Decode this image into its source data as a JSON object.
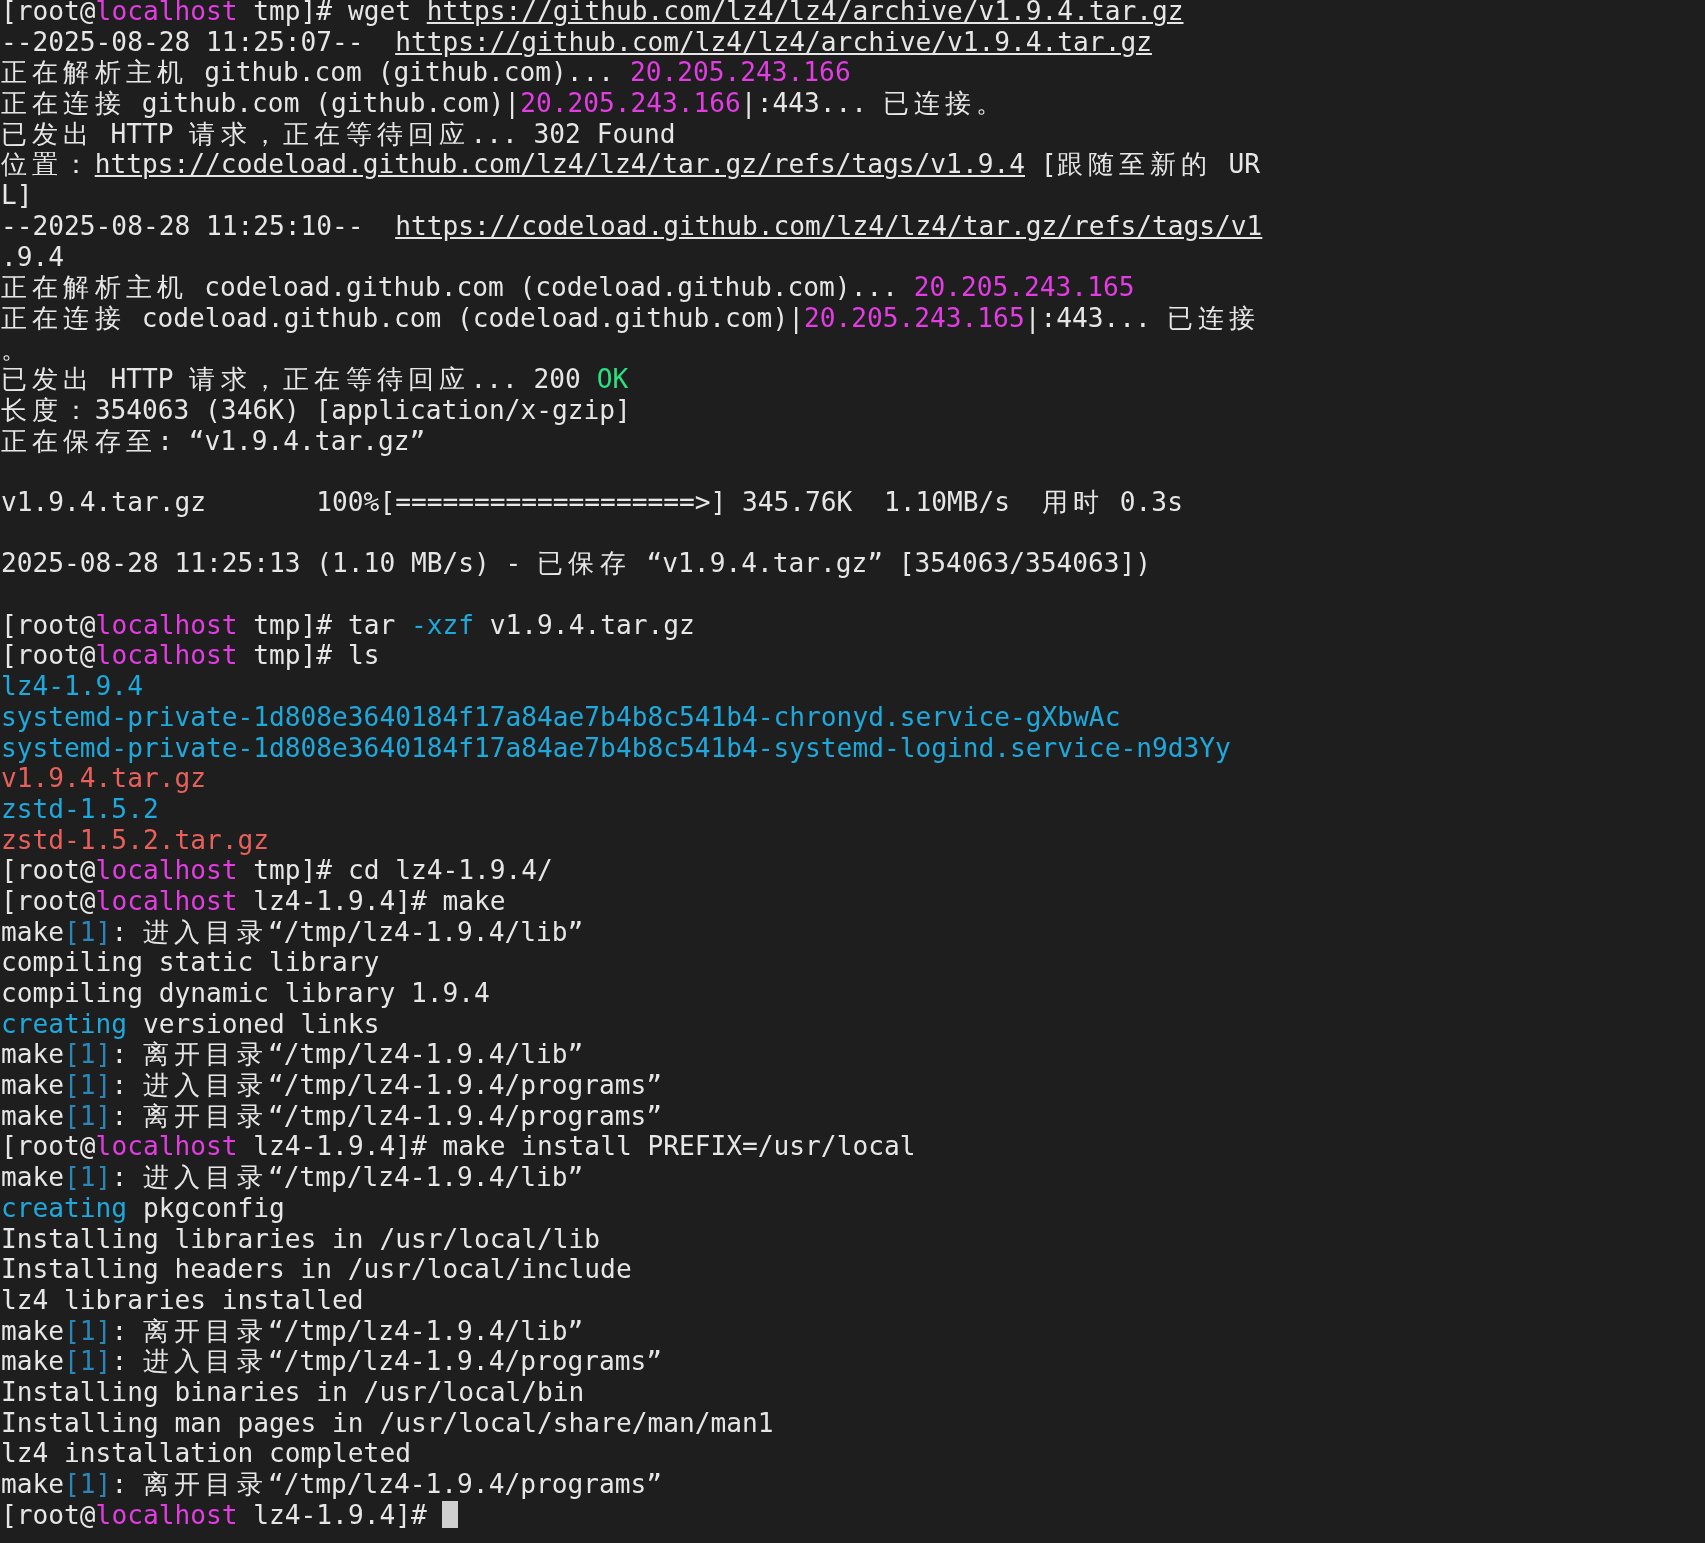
{
  "terminal": {
    "lines": [
      {
        "kind": "text",
        "segments": [
          {
            "kind": "plain",
            "text": "[root@"
          },
          {
            "kind": "host",
            "text": "localhost"
          },
          {
            "kind": "plain",
            "text": " tmp]# wget "
          },
          {
            "kind": "link",
            "text": "https://github.com/lz4/lz4/archive/v1.9.4.tar.gz"
          }
        ]
      },
      {
        "kind": "text",
        "segments": [
          {
            "kind": "plain",
            "text": "--2025-08-28 11:25:07--  "
          },
          {
            "kind": "link",
            "text": "https://github.com/lz4/lz4/archive/v1.9.4.tar.gz"
          }
        ]
      },
      {
        "kind": "text",
        "segments": [
          {
            "kind": "plain",
            "text": "正在解析主机 github.com (github.com)... "
          },
          {
            "kind": "ip",
            "text": "20.205.243.166"
          }
        ]
      },
      {
        "kind": "text",
        "segments": [
          {
            "kind": "plain",
            "text": "正在连接 github.com (github.com)|"
          },
          {
            "kind": "ip",
            "text": "20.205.243.166"
          },
          {
            "kind": "plain",
            "text": "|:443... 已连接。"
          }
        ]
      },
      {
        "kind": "text",
        "segments": [
          {
            "kind": "plain",
            "text": "已发出 HTTP 请求，正在等待回应... 302 Found"
          }
        ]
      },
      {
        "kind": "text",
        "segments": [
          {
            "kind": "plain",
            "text": "位置："
          },
          {
            "kind": "link",
            "text": "https://codeload.github.com/lz4/lz4/tar.gz/refs/tags/v1.9.4"
          },
          {
            "kind": "plain",
            "text": " [跟随至新的 UR"
          }
        ]
      },
      {
        "kind": "text",
        "segments": [
          {
            "kind": "plain",
            "text": "L]"
          }
        ]
      },
      {
        "kind": "text",
        "segments": [
          {
            "kind": "plain",
            "text": "--2025-08-28 11:25:10--  "
          },
          {
            "kind": "link",
            "text": "https://codeload.github.com/lz4/lz4/tar.gz/refs/tags/v1"
          }
        ]
      },
      {
        "kind": "text",
        "segments": [
          {
            "kind": "plain",
            "text": ".9.4"
          }
        ]
      },
      {
        "kind": "text",
        "segments": [
          {
            "kind": "plain",
            "text": "正在解析主机 codeload.github.com (codeload.github.com)... "
          },
          {
            "kind": "ip",
            "text": "20.205.243.165"
          }
        ]
      },
      {
        "kind": "text",
        "segments": [
          {
            "kind": "plain",
            "text": "正在连接 codeload.github.com (codeload.github.com)|"
          },
          {
            "kind": "ip",
            "text": "20.205.243.165"
          },
          {
            "kind": "plain",
            "text": "|:443... 已连接"
          }
        ]
      },
      {
        "kind": "text",
        "segments": [
          {
            "kind": "plain",
            "text": "。"
          }
        ]
      },
      {
        "kind": "text",
        "segments": [
          {
            "kind": "plain",
            "text": "已发出 HTTP 请求，正在等待回应... 200 "
          },
          {
            "kind": "ok",
            "text": "OK"
          }
        ]
      },
      {
        "kind": "text",
        "segments": [
          {
            "kind": "plain",
            "text": "长度：354063 (346K) [application/x-gzip]"
          }
        ]
      },
      {
        "kind": "text",
        "segments": [
          {
            "kind": "plain",
            "text": "正在保存至: “v1.9.4.tar.gz”"
          }
        ]
      },
      {
        "kind": "blank"
      },
      {
        "kind": "text",
        "segments": [
          {
            "kind": "plain",
            "text": "v1.9.4.tar.gz       100%[===================>] 345.76K  1.10MB/s  用时 0.3s"
          }
        ]
      },
      {
        "kind": "blank"
      },
      {
        "kind": "text",
        "segments": [
          {
            "kind": "plain",
            "text": "2025-08-28 11:25:13 (1.10 MB/s) - 已保存 “v1.9.4.tar.gz” [354063/354063])"
          }
        ]
      },
      {
        "kind": "blank"
      },
      {
        "kind": "text",
        "segments": [
          {
            "kind": "plain",
            "text": "[root@"
          },
          {
            "kind": "host",
            "text": "localhost"
          },
          {
            "kind": "plain",
            "text": " tmp]# tar "
          },
          {
            "kind": "option",
            "text": "-xzf"
          },
          {
            "kind": "plain",
            "text": " v1.9.4.tar.gz"
          }
        ]
      },
      {
        "kind": "text",
        "segments": [
          {
            "kind": "plain",
            "text": "[root@"
          },
          {
            "kind": "host",
            "text": "localhost"
          },
          {
            "kind": "plain",
            "text": " tmp]# ls"
          }
        ]
      },
      {
        "kind": "text",
        "segments": [
          {
            "kind": "dir",
            "text": "lz4-1.9.4"
          }
        ]
      },
      {
        "kind": "text",
        "segments": [
          {
            "kind": "dir",
            "text": "systemd-private-1d808e3640184f17a84ae7b4b8c541b4-chronyd.service-gXbwAc"
          }
        ]
      },
      {
        "kind": "text",
        "segments": [
          {
            "kind": "dir",
            "text": "systemd-private-1d808e3640184f17a84ae7b4b8c541b4-systemd-logind.service-n9d3Yy"
          }
        ]
      },
      {
        "kind": "text",
        "segments": [
          {
            "kind": "archive",
            "text": "v1.9.4.tar.gz"
          }
        ]
      },
      {
        "kind": "text",
        "segments": [
          {
            "kind": "dir",
            "text": "zstd-1.5.2"
          }
        ]
      },
      {
        "kind": "text",
        "segments": [
          {
            "kind": "archive",
            "text": "zstd-1.5.2.tar.gz"
          }
        ]
      },
      {
        "kind": "text",
        "segments": [
          {
            "kind": "plain",
            "text": "[root@"
          },
          {
            "kind": "host",
            "text": "localhost"
          },
          {
            "kind": "plain",
            "text": " tmp]# cd lz4-1.9.4/"
          }
        ]
      },
      {
        "kind": "text",
        "segments": [
          {
            "kind": "plain",
            "text": "[root@"
          },
          {
            "kind": "host",
            "text": "localhost"
          },
          {
            "kind": "plain",
            "text": " lz4-1.9.4]# make"
          }
        ]
      },
      {
        "kind": "text",
        "segments": [
          {
            "kind": "plain",
            "text": "make"
          },
          {
            "kind": "level",
            "text": "[1]"
          },
          {
            "kind": "plain",
            "text": ": 进入目录“/tmp/lz4-1.9.4/lib”"
          }
        ]
      },
      {
        "kind": "text",
        "segments": [
          {
            "kind": "plain",
            "text": "compiling static library"
          }
        ]
      },
      {
        "kind": "text",
        "segments": [
          {
            "kind": "plain",
            "text": "compiling dynamic library 1.9.4"
          }
        ]
      },
      {
        "kind": "text",
        "segments": [
          {
            "kind": "action",
            "text": "creating"
          },
          {
            "kind": "plain",
            "text": " versioned links"
          }
        ]
      },
      {
        "kind": "text",
        "segments": [
          {
            "kind": "plain",
            "text": "make"
          },
          {
            "kind": "level",
            "text": "[1]"
          },
          {
            "kind": "plain",
            "text": ": 离开目录“/tmp/lz4-1.9.4/lib”"
          }
        ]
      },
      {
        "kind": "text",
        "segments": [
          {
            "kind": "plain",
            "text": "make"
          },
          {
            "kind": "level",
            "text": "[1]"
          },
          {
            "kind": "plain",
            "text": ": 进入目录“/tmp/lz4-1.9.4/programs”"
          }
        ]
      },
      {
        "kind": "text",
        "segments": [
          {
            "kind": "plain",
            "text": "make"
          },
          {
            "kind": "level",
            "text": "[1]"
          },
          {
            "kind": "plain",
            "text": ": 离开目录“/tmp/lz4-1.9.4/programs”"
          }
        ]
      },
      {
        "kind": "text",
        "segments": [
          {
            "kind": "plain",
            "text": "[root@"
          },
          {
            "kind": "host",
            "text": "localhost"
          },
          {
            "kind": "plain",
            "text": " lz4-1.9.4]# make install PREFIX=/usr/local"
          }
        ]
      },
      {
        "kind": "text",
        "segments": [
          {
            "kind": "plain",
            "text": "make"
          },
          {
            "kind": "level",
            "text": "[1]"
          },
          {
            "kind": "plain",
            "text": ": 进入目录“/tmp/lz4-1.9.4/lib”"
          }
        ]
      },
      {
        "kind": "text",
        "segments": [
          {
            "kind": "action",
            "text": "creating"
          },
          {
            "kind": "plain",
            "text": " pkgconfig"
          }
        ]
      },
      {
        "kind": "text",
        "segments": [
          {
            "kind": "plain",
            "text": "Installing libraries in /usr/local/lib"
          }
        ]
      },
      {
        "kind": "text",
        "segments": [
          {
            "kind": "plain",
            "text": "Installing headers in /usr/local/include"
          }
        ]
      },
      {
        "kind": "text",
        "segments": [
          {
            "kind": "plain",
            "text": "lz4 libraries installed"
          }
        ]
      },
      {
        "kind": "text",
        "segments": [
          {
            "kind": "plain",
            "text": "make"
          },
          {
            "kind": "level",
            "text": "[1]"
          },
          {
            "kind": "plain",
            "text": ": 离开目录“/tmp/lz4-1.9.4/lib”"
          }
        ]
      },
      {
        "kind": "text",
        "segments": [
          {
            "kind": "plain",
            "text": "make"
          },
          {
            "kind": "level",
            "text": "[1]"
          },
          {
            "kind": "plain",
            "text": ": 进入目录“/tmp/lz4-1.9.4/programs”"
          }
        ]
      },
      {
        "kind": "text",
        "segments": [
          {
            "kind": "plain",
            "text": "Installing binaries in /usr/local/bin"
          }
        ]
      },
      {
        "kind": "text",
        "segments": [
          {
            "kind": "plain",
            "text": "Installing man pages in /usr/local/share/man/man1"
          }
        ]
      },
      {
        "kind": "text",
        "segments": [
          {
            "kind": "plain",
            "text": "lz4 installation completed"
          }
        ]
      },
      {
        "kind": "text",
        "segments": [
          {
            "kind": "plain",
            "text": "make"
          },
          {
            "kind": "level",
            "text": "[1]"
          },
          {
            "kind": "plain",
            "text": ": 离开目录“/tmp/lz4-1.9.4/programs”"
          }
        ]
      },
      {
        "kind": "text",
        "cursor": true,
        "segments": [
          {
            "kind": "plain",
            "text": "[root@"
          },
          {
            "kind": "host",
            "text": "localhost"
          },
          {
            "kind": "plain",
            "text": " lz4-1.9.4]# "
          }
        ]
      }
    ]
  }
}
